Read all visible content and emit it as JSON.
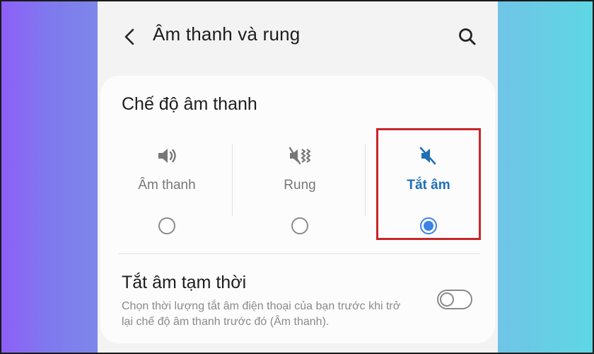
{
  "header": {
    "title": "Âm thanh và rung",
    "back_icon": "back-arrow-icon",
    "search_icon": "search-icon"
  },
  "sound_mode": {
    "title": "Chế độ âm thanh",
    "options": [
      {
        "label": "Âm thanh",
        "icon": "speaker-icon",
        "selected": false
      },
      {
        "label": "Rung",
        "icon": "vibrate-icon",
        "selected": false
      },
      {
        "label": "Tắt âm",
        "icon": "mute-icon",
        "selected": true
      }
    ]
  },
  "temp_mute": {
    "title": "Tắt âm tạm thời",
    "description": "Chọn thời lượng tắt âm điện thoại của bạn trước khi trở lại chế độ âm thanh trước đó (Âm thanh).",
    "enabled": false
  },
  "colors": {
    "accent": "#3a82e6",
    "selected_label": "#1f6fb6",
    "highlight_box": "#c8262b",
    "background_left": "#8d5ff7",
    "background_right": "#5ed7e4"
  }
}
